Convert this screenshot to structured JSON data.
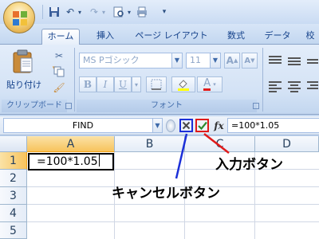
{
  "tabs": [
    {
      "label": "ホーム",
      "active": true
    },
    {
      "label": "挿入"
    },
    {
      "label": "ページ レイアウト"
    },
    {
      "label": "数式"
    },
    {
      "label": "データ"
    },
    {
      "label": "校"
    }
  ],
  "clipboard": {
    "paste_label": "貼り付け",
    "caption": "クリップボード"
  },
  "font": {
    "font_name": "MS Pゴシック",
    "font_size": "11",
    "grow_label": "A",
    "shrink_label": "A",
    "bold": "B",
    "italic": "I",
    "underline": "U",
    "font_color_label": "A",
    "caption": "フォント"
  },
  "formula_bar": {
    "name_box": "FIND",
    "fx": "fx",
    "formula": "=100*1.05"
  },
  "sheet": {
    "columns": [
      "A",
      "B",
      "C",
      "D"
    ],
    "rows": [
      "1",
      "2",
      "3",
      "4",
      "5"
    ],
    "active_cell_value": "=100*1.05"
  },
  "annotations": {
    "enter_label": "入力ボタン",
    "cancel_label": "キャンセルボタン",
    "enter_color": "#e01b1b",
    "cancel_color": "#1b2fd8"
  },
  "colors": {
    "ribbon": "#dbe7f6",
    "selected_header": "#f7c35d"
  }
}
